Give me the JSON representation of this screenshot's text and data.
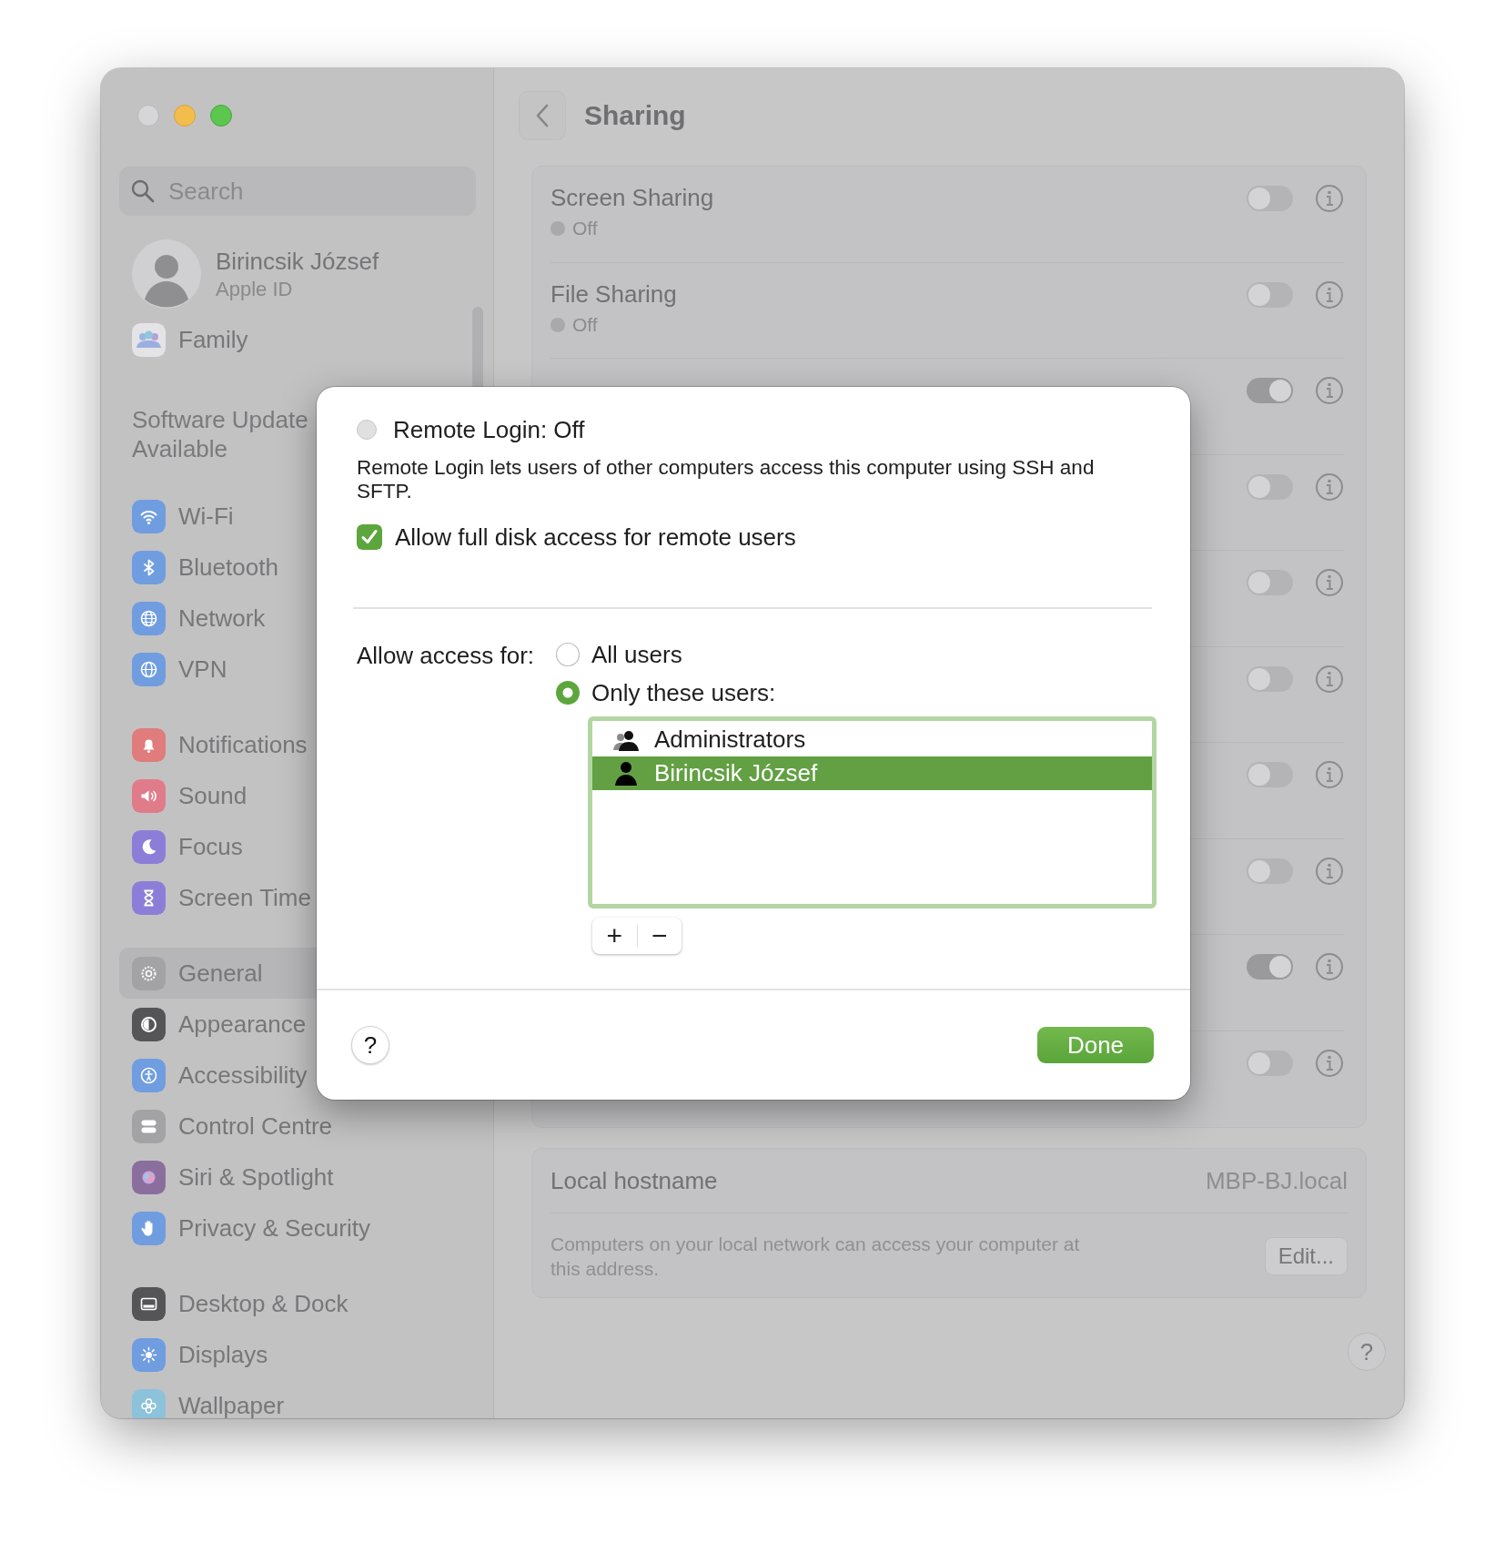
{
  "sidebar": {
    "search": {
      "placeholder": "Search"
    },
    "account": {
      "name": "Birincsik József",
      "subtitle": "Apple ID"
    },
    "family": {
      "label": "Family"
    },
    "update_notice": "Software Update Available",
    "groups": [
      {
        "items": [
          {
            "label": "Wi-Fi",
            "color": "#6f9de0",
            "selected": false
          },
          {
            "label": "Bluetooth",
            "color": "#6f9de0",
            "selected": false
          },
          {
            "label": "Network",
            "color": "#6f9de0",
            "selected": false
          },
          {
            "label": "VPN",
            "color": "#6f9de0",
            "selected": false
          }
        ]
      },
      {
        "items": [
          {
            "label": "Notifications",
            "color": "#e07c7c",
            "selected": false
          },
          {
            "label": "Sound",
            "color": "#e07c8a",
            "selected": false
          },
          {
            "label": "Focus",
            "color": "#8c7ed8",
            "selected": false
          },
          {
            "label": "Screen Time",
            "color": "#8c7ed8",
            "selected": false
          }
        ]
      },
      {
        "items": [
          {
            "label": "General",
            "color": "#a3a3a6",
            "selected": true
          },
          {
            "label": "Appearance",
            "color": "#555558",
            "selected": false
          },
          {
            "label": "Accessibility",
            "color": "#6f9de0",
            "selected": false
          },
          {
            "label": "Control Centre",
            "color": "#a3a3a6",
            "selected": false
          },
          {
            "label": "Siri & Spotlight",
            "color": "#8a6f9e",
            "selected": false
          },
          {
            "label": "Privacy & Security",
            "color": "#6f9de0",
            "selected": false
          }
        ]
      },
      {
        "items": [
          {
            "label": "Desktop & Dock",
            "color": "#555558",
            "selected": false
          },
          {
            "label": "Displays",
            "color": "#6f9de0",
            "selected": false
          },
          {
            "label": "Wallpaper",
            "color": "#8cc2da",
            "selected": false
          }
        ]
      }
    ]
  },
  "main": {
    "title": "Sharing",
    "services": [
      {
        "label": "Screen Sharing",
        "status": "Off",
        "on": false
      },
      {
        "label": "File Sharing",
        "status": "Off",
        "on": false
      },
      {
        "on": true
      },
      {
        "on": false
      },
      {
        "on": false
      },
      {
        "on": false
      },
      {
        "on": false
      },
      {
        "on": false
      },
      {
        "on": true
      },
      {
        "on": false
      }
    ],
    "hostname": {
      "label": "Local hostname",
      "value": "MBP-BJ.local",
      "description": "Computers on your local network can access your computer at this address.",
      "button": "Edit..."
    },
    "help": "?"
  },
  "dialog": {
    "service": {
      "title": "Remote Login: Off",
      "on": false
    },
    "description": "Remote Login lets users of other computers access this computer using SSH and SFTP.",
    "full_disk": {
      "label": "Allow full disk access for remote users",
      "checked": true
    },
    "access": {
      "label": "Allow access for:",
      "options": [
        {
          "label": "All users",
          "selected": false
        },
        {
          "label": "Only these users:",
          "selected": true
        }
      ]
    },
    "users": [
      {
        "name": "Administrators",
        "kind": "group",
        "selected": false
      },
      {
        "name": "Birincsik József",
        "kind": "user",
        "selected": true
      }
    ],
    "list_buttons": [
      "+",
      "−"
    ],
    "help": "?",
    "done": "Done"
  }
}
